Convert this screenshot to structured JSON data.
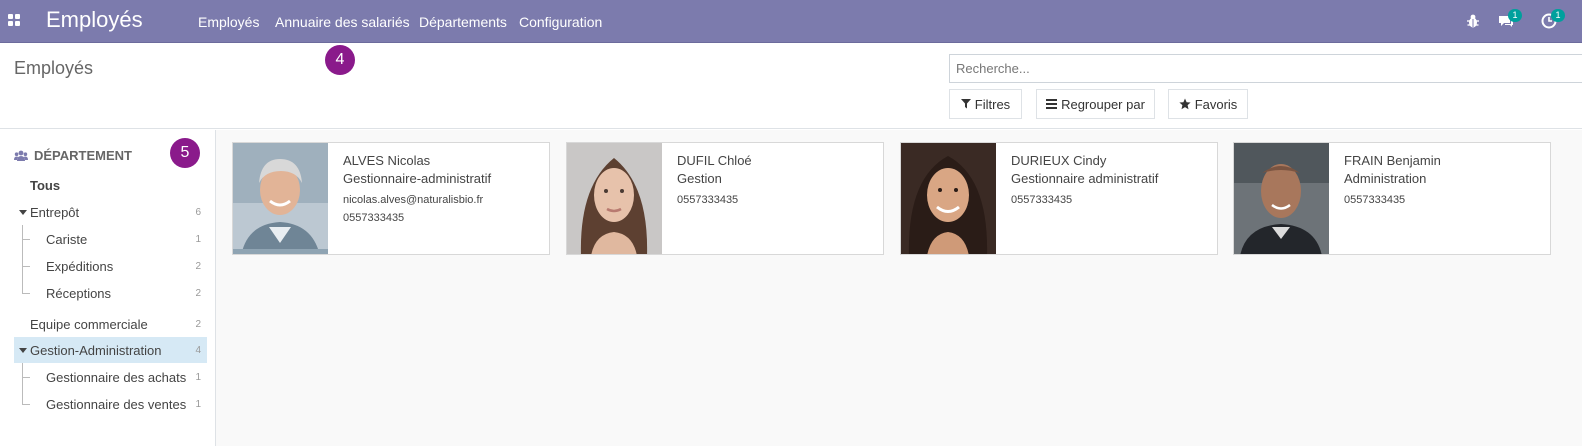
{
  "navbar": {
    "app_title": "Employés",
    "menu": [
      {
        "label": "Employés"
      },
      {
        "label": "Annuaire des salariés"
      },
      {
        "label": "Départements"
      },
      {
        "label": "Configuration"
      }
    ],
    "messages_count": "1",
    "activities_count": "1"
  },
  "control_panel": {
    "title": "Employés",
    "search_placeholder": "Recherche...",
    "filters_label": "Filtres",
    "group_by_label": "Regrouper par",
    "favorites_label": "Favoris"
  },
  "tutorial_markers": [
    "4",
    "5"
  ],
  "side_panel": {
    "header": "DÉPARTEMENT",
    "all_label": "Tous",
    "items": [
      {
        "label": "Entrepôt",
        "count": "6"
      },
      {
        "label": "Cariste",
        "count": "1"
      },
      {
        "label": "Expéditions",
        "count": "2"
      },
      {
        "label": "Réceptions",
        "count": "2"
      },
      {
        "label": "Equipe commerciale",
        "count": "2"
      },
      {
        "label": "Gestion-Administration",
        "count": "4"
      },
      {
        "label": "Gestionnaire des achats",
        "count": "1"
      },
      {
        "label": "Gestionnaire des ventes",
        "count": "1"
      }
    ]
  },
  "employees": [
    {
      "name": "ALVES Nicolas",
      "job": "Gestionnaire-administratif",
      "email": "nicolas.alves@naturalisbio.fr",
      "phone": "0557333435"
    },
    {
      "name": "DUFIL Chloé",
      "job": "Gestion",
      "email": "",
      "phone": "0557333435"
    },
    {
      "name": "DURIEUX Cindy",
      "job": "Gestionnaire administratif",
      "email": "",
      "phone": "0557333435"
    },
    {
      "name": "FRAIN Benjamin",
      "job": "Administration",
      "email": "",
      "phone": "0557333435"
    }
  ],
  "colors": {
    "navbar": "#7c7bad",
    "marker": "#8a1a8b",
    "badge": "#00a09d",
    "active_row": "#d6e9f5"
  }
}
